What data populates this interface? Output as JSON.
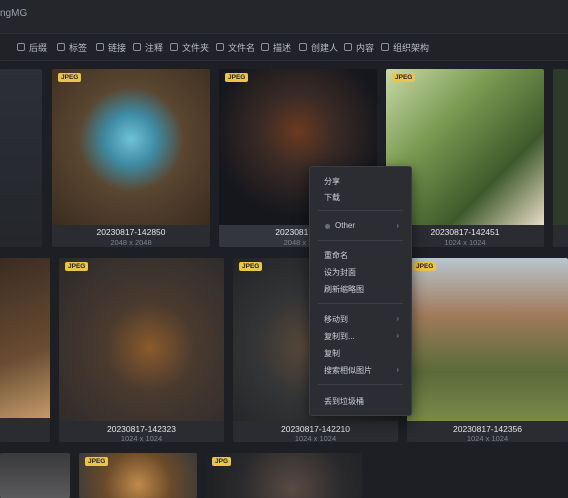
{
  "app": {
    "title": "ngMG"
  },
  "filters": [
    "后缀",
    "标签",
    "链接",
    "注释",
    "文件夹",
    "文件名",
    "描述",
    "创建人",
    "内容",
    "组织架构"
  ],
  "cards": [
    {
      "badge": "JPEG",
      "name": "20230817-142850",
      "dims": "2048 x 2048"
    },
    {
      "badge": "JPEG",
      "name": "20230817-1",
      "dims": "2048 x 2"
    },
    {
      "badge": "JPEG",
      "name": "20230817-142451",
      "dims": "1024 x 1024"
    },
    {
      "badge": "JPEG",
      "name": "20230817-142323",
      "dims": "1024 x 1024"
    },
    {
      "badge": "JPEG",
      "name": "20230817-142210",
      "dims": "1024 x 1024"
    },
    {
      "badge": "JPEG",
      "name": "20230817-142356",
      "dims": "1024 x 1024"
    },
    {
      "badge": "JPEG",
      "name": "",
      "dims": ""
    },
    {
      "badge": "JPG",
      "name": "",
      "dims": ""
    }
  ],
  "context_menu": {
    "items": [
      "分享",
      "下载",
      "Other",
      "重命名",
      "设为封面",
      "刷新缩略图",
      "移动到",
      "复制到...",
      "复制",
      "搜索相似图片",
      "丢到垃圾桶"
    ]
  }
}
